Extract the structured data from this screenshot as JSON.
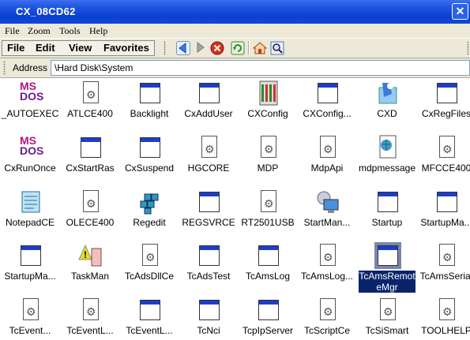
{
  "window": {
    "title": "CX_08CD62",
    "close": "✕"
  },
  "menu": [
    "File",
    "Zoom",
    "Tools",
    "Help"
  ],
  "toolbar": {
    "labels": [
      "File",
      "Edit",
      "View",
      "Favorites"
    ]
  },
  "address": {
    "label": "Address",
    "value": "\\Hard Disk\\System"
  },
  "items": [
    {
      "label": "_AUTOEXEC",
      "icon": "msdos-icon"
    },
    {
      "label": "ATLCE400",
      "icon": "dll-gear-icon"
    },
    {
      "label": "Backlight",
      "icon": "app-window-icon"
    },
    {
      "label": "CxAddUser",
      "icon": "app-window-icon"
    },
    {
      "label": "CXConfig",
      "icon": "config-grid-icon"
    },
    {
      "label": "CXConfig...",
      "icon": "app-window-icon"
    },
    {
      "label": "CXD",
      "icon": "cxd-icon"
    },
    {
      "label": "CxRegFiles",
      "icon": "app-window-icon"
    },
    {
      "label": "CxRunOnce",
      "icon": "msdos-icon"
    },
    {
      "label": "CxStartRas",
      "icon": "app-window-icon"
    },
    {
      "label": "CxSuspend",
      "icon": "app-window-icon"
    },
    {
      "label": "HGCORE",
      "icon": "dll-gear-icon"
    },
    {
      "label": "MDP",
      "icon": "dll-gear-icon"
    },
    {
      "label": "MdpApi",
      "icon": "dll-gear-icon"
    },
    {
      "label": "mdpmessage",
      "icon": "html-doc-icon"
    },
    {
      "label": "MFCCE400",
      "icon": "dll-gear-icon"
    },
    {
      "label": "NotepadCE",
      "icon": "notepad-icon"
    },
    {
      "label": "OLECE400",
      "icon": "dll-gear-icon"
    },
    {
      "label": "Regedit",
      "icon": "regedit-icon"
    },
    {
      "label": "REGSVRCE",
      "icon": "app-window-icon"
    },
    {
      "label": "RT2501USB",
      "icon": "dll-gear-icon"
    },
    {
      "label": "StartMan...",
      "icon": "network-pc-icon"
    },
    {
      "label": "Startup",
      "icon": "app-window-icon"
    },
    {
      "label": "StartupMa...",
      "icon": "app-window-icon"
    },
    {
      "label": "StartupMa...",
      "icon": "app-window-icon"
    },
    {
      "label": "TaskMan",
      "icon": "taskman-icon"
    },
    {
      "label": "TcAdsDllCe",
      "icon": "dll-gear-icon"
    },
    {
      "label": "TcAdsTest",
      "icon": "app-window-icon"
    },
    {
      "label": "TcAmsLog",
      "icon": "app-window-icon"
    },
    {
      "label": "TcAmsLog...",
      "icon": "dll-gear-icon"
    },
    {
      "label": "TcAmsRemoteMgr",
      "icon": "app-window-icon",
      "selected": true
    },
    {
      "label": "TcAmsSerial",
      "icon": "dll-gear-icon"
    },
    {
      "label": "TcEvent...",
      "icon": "dll-gear-icon"
    },
    {
      "label": "TcEventL...",
      "icon": "dll-gear-icon"
    },
    {
      "label": "TcEventL...",
      "icon": "app-window-icon"
    },
    {
      "label": "TcNci",
      "icon": "app-window-icon"
    },
    {
      "label": "TcpIpServer",
      "icon": "app-window-icon"
    },
    {
      "label": "TcScriptCe",
      "icon": "dll-gear-icon"
    },
    {
      "label": "TcSiSmart",
      "icon": "dll-gear-icon"
    },
    {
      "label": "TOOLHELP",
      "icon": "dll-gear-icon"
    }
  ]
}
